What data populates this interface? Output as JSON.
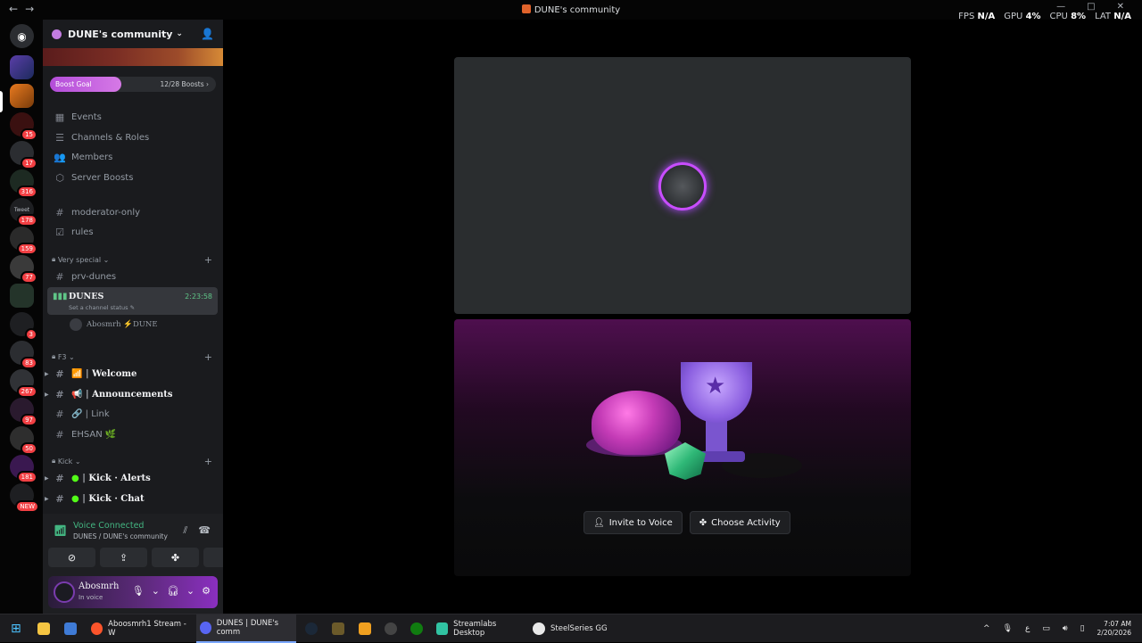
{
  "window": {
    "title": "DUNE's community",
    "nav_back": "←",
    "nav_fwd": "→"
  },
  "overlay": {
    "fps_label": "FPS",
    "fps_value": "N/A",
    "gpu_label": "GPU",
    "gpu_value": "4%",
    "cpu_label": "CPU",
    "cpu_value": "8%",
    "lat_label": "LAT",
    "lat_value": "N/A"
  },
  "guild_badges": [
    "15",
    "17",
    "316",
    "178",
    "159",
    "77",
    "3",
    "83",
    "267",
    "97",
    "50",
    "181",
    "NEW"
  ],
  "guild_label_tweet": "Tweet",
  "server": {
    "name": "DUNE's community",
    "boost_label": "Boost Goal",
    "boost_count": "12/28 Boosts",
    "boost_progress": 0.43
  },
  "menu": [
    {
      "label": "Events",
      "icon": "calendar-icon"
    },
    {
      "label": "Channels & Roles",
      "icon": "list-icon"
    },
    {
      "label": "Members",
      "icon": "members-icon"
    },
    {
      "label": "Server Boosts",
      "icon": "boost-icon"
    }
  ],
  "channels_top": [
    {
      "label": "moderator-only"
    },
    {
      "label": "rules"
    }
  ],
  "category_very_special": "Very special",
  "channel_prv": "prv-dunes",
  "voice_channel": {
    "name": "DUNES",
    "time": "2:23:58",
    "status": "Set a channel status"
  },
  "voice_user": "Abosmrh ⚡DUNE",
  "category_f3": "F3",
  "f3_channels": [
    {
      "label": "Welcome",
      "emoji": "📶",
      "sep": "|"
    },
    {
      "label": "Announcements",
      "emoji": "📢",
      "sep": "|"
    },
    {
      "label": "Link",
      "emoji": "🔗",
      "sep": "|"
    },
    {
      "label": "EHSAN 🌿",
      "emoji": "",
      "sep": ""
    }
  ],
  "category_kick": "Kick",
  "kick_channels": [
    {
      "label": "Kick · Alerts",
      "sep": "|"
    },
    {
      "label": "Kick · Chat",
      "sep": "|"
    }
  ],
  "voice_panel": {
    "title": "Voice Connected",
    "subtitle": "DUNES / DUNE's community"
  },
  "user": {
    "name": "Abosmrh",
    "status": "In voice"
  },
  "stage": {
    "invite_label": "Invite to Voice",
    "activity_label": "Choose Activity"
  },
  "taskbar": {
    "items": [
      {
        "label": "Aboosmrh1 Stream - W"
      },
      {
        "label": "DUNES | DUNE's comm"
      },
      {
        "label": "Streamlabs Desktop"
      },
      {
        "label": "SteelSeries GG"
      }
    ],
    "time": "7:07 AM",
    "date": "2/20/2026",
    "lang": "ع"
  }
}
